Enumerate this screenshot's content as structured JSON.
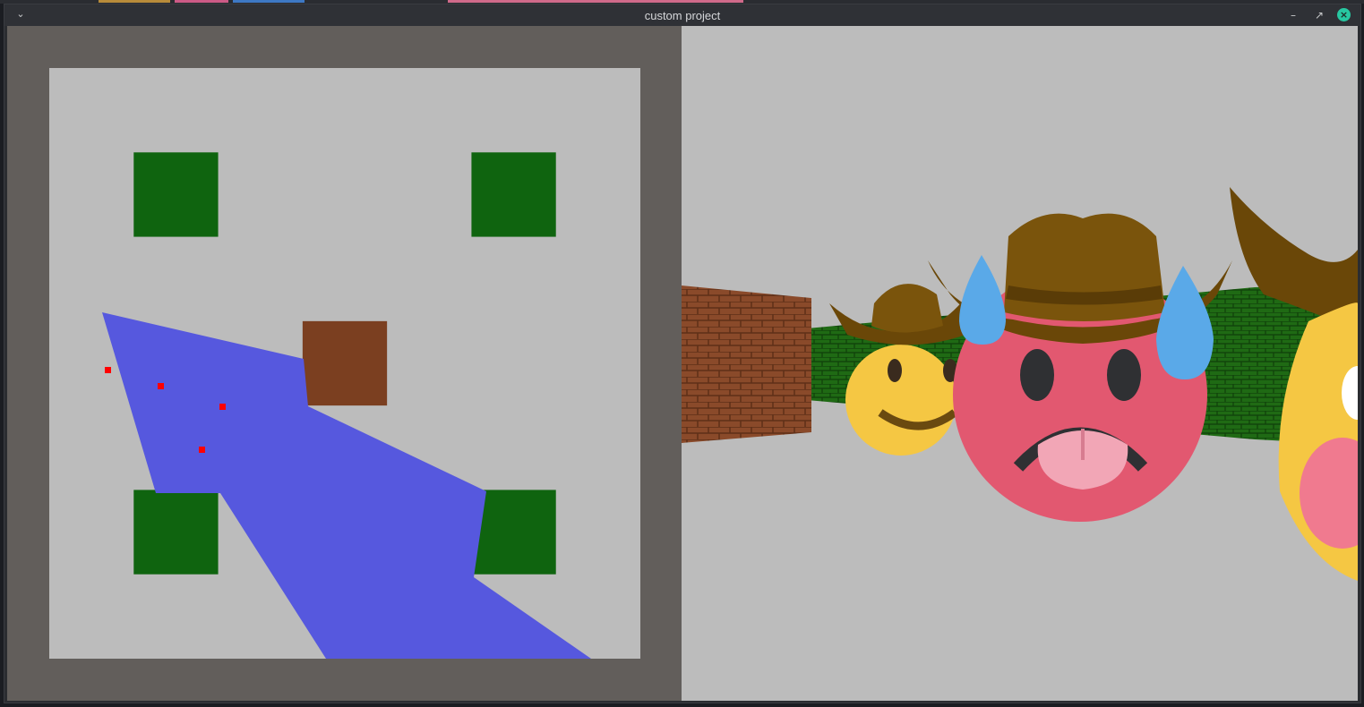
{
  "window": {
    "title": "custom project",
    "menu_icon": "chevron-down-icon",
    "controls": {
      "minimize_icon": "minimize-icon",
      "maximize_icon": "maximize-icon",
      "close_icon": "close-icon"
    }
  },
  "colors": {
    "map_border": "#625e5b",
    "map_floor": "#bcbcbc",
    "wall_green": "#0f640f",
    "wall_brick": "#7b3f20",
    "view_cone": "#5658de",
    "entity_dot": "#ff0000",
    "view_floor": "#bcbcbc",
    "brick_wall_3d": "#8a4a2a",
    "green_wall_3d": "#1f6a14"
  },
  "map": {
    "grid_size": 7,
    "walls": [
      {
        "col": 1,
        "row": 1,
        "type": "green"
      },
      {
        "col": 5,
        "row": 1,
        "type": "green"
      },
      {
        "col": 3,
        "row": 3,
        "type": "brick"
      },
      {
        "col": 1,
        "row": 5,
        "type": "green"
      },
      {
        "col": 5,
        "row": 5,
        "type": "green"
      }
    ],
    "entities_count": 4
  },
  "view": {
    "sprites": [
      "cowboy-smiley-sprite",
      "cowboy-sweat-tongue-sprite",
      "cowboy-partial-sprite"
    ],
    "walls": [
      "brick-wall-3d",
      "green-wall-3d"
    ]
  }
}
